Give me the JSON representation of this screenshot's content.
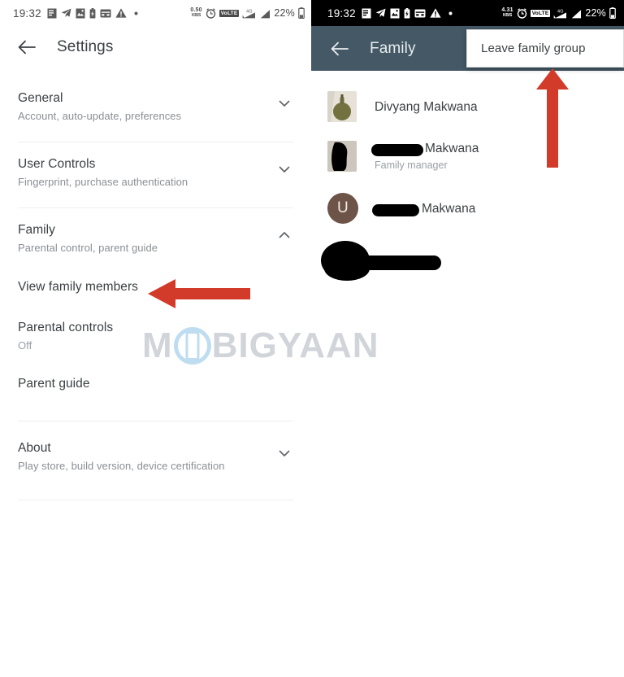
{
  "left_panel": {
    "status_bar": {
      "time": "19:32",
      "icons": [
        "document-icon",
        "telegram-icon",
        "photos-icon",
        "battery-saver-icon",
        "card-icon",
        "warning-icon",
        "dot-icon"
      ],
      "data_rate": "0.50",
      "data_rate_unit": "KB/S",
      "alarm_icon": "alarm-icon",
      "volte_label": "VoLTE",
      "network_type": "4G+",
      "battery_percent": "22%"
    },
    "appbar": {
      "back_icon": "back-arrow-icon",
      "title": "Settings"
    },
    "settings": [
      {
        "id": "general",
        "title": "General",
        "subtitle": "Account, auto-update, preferences",
        "chevron": "chevron-down-icon"
      },
      {
        "id": "user-controls",
        "title": "User Controls",
        "subtitle": "Fingerprint, purchase authentication",
        "chevron": "chevron-down-icon"
      },
      {
        "id": "family",
        "title": "Family",
        "subtitle": "Parental control, parent guide",
        "chevron": "chevron-up-icon"
      }
    ],
    "family_sub_items": [
      {
        "id": "view-family-members",
        "title": "View family members",
        "subtitle": ""
      },
      {
        "id": "parental-controls",
        "title": "Parental controls",
        "subtitle": "Off"
      },
      {
        "id": "parent-guide",
        "title": "Parent guide",
        "subtitle": ""
      }
    ],
    "about": {
      "id": "about",
      "title": "About",
      "subtitle": "Play store, build version, device certification",
      "chevron": "chevron-down-icon"
    }
  },
  "right_panel": {
    "status_bar": {
      "time": "19:32",
      "icons": [
        "document-icon",
        "telegram-icon",
        "photos-icon",
        "battery-saver-icon",
        "card-icon",
        "warning-icon",
        "dot-icon"
      ],
      "data_rate": "4.31",
      "data_rate_unit": "KB/S",
      "alarm_icon": "alarm-icon",
      "volte_label": "VoLTE",
      "network_type": "4G+",
      "battery_percent": "22%"
    },
    "appbar": {
      "back_icon": "back-arrow-icon",
      "title": "Family"
    },
    "popup_menu": {
      "items": [
        {
          "id": "leave-family-group",
          "label": "Leave family group"
        }
      ]
    },
    "members": [
      {
        "id": "member-1",
        "avatar_type": "photo",
        "avatar_letter": "",
        "name": "Divyang Makwana",
        "role": "",
        "redacted_name": false
      },
      {
        "id": "member-2",
        "avatar_type": "photo-redacted",
        "avatar_letter": "",
        "name": "Makwana",
        "role": "Family manager",
        "redacted_name": true
      },
      {
        "id": "member-3",
        "avatar_type": "letter",
        "avatar_letter": "U",
        "name": "Makwana",
        "role": "",
        "redacted_name": true
      },
      {
        "id": "member-4",
        "avatar_type": "redacted-blob",
        "avatar_letter": "",
        "name": "",
        "role": "",
        "redacted_name": true
      }
    ]
  },
  "watermark": {
    "text_before": "M",
    "icon": "phone-in-circle-icon",
    "text_after": "BIGYAAN"
  },
  "annotations": [
    {
      "id": "arrow-view-family-members",
      "direction": "left",
      "color": "#d23b2a"
    },
    {
      "id": "arrow-leave-family-group",
      "direction": "up",
      "color": "#d23b2a"
    }
  ],
  "colors": {
    "appbar_dark": "#445965",
    "arrow_red": "#d23b2a",
    "avatar_letter_bg": "#6d5348",
    "watermark_gray": "#cfd3d8",
    "watermark_blue": "#bcdcf0"
  }
}
